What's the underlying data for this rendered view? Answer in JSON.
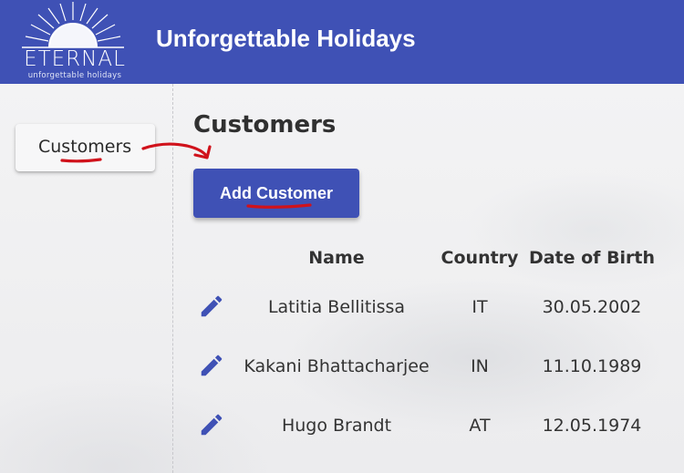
{
  "header": {
    "logo_word": "ETERNAL",
    "logo_tagline": "unforgettable holidays",
    "title": "Unforgettable Holidays",
    "color": "#3f51b5"
  },
  "sidebar": {
    "items": [
      {
        "label": "Customers",
        "icon": "none",
        "active": true
      }
    ]
  },
  "main": {
    "page_title": "Customers",
    "add_button_label": "Add Customer",
    "table": {
      "columns": [
        "",
        "Name",
        "Country",
        "Date of Birth"
      ],
      "rows": [
        {
          "edit_icon": "edit-pencil-icon",
          "name": "Latitia Bellitissa",
          "country": "IT",
          "dob": "30.05.2002"
        },
        {
          "edit_icon": "edit-pencil-icon",
          "name": "Kakani Bhattacharjee",
          "country": "IN",
          "dob": "11.10.1989"
        },
        {
          "edit_icon": "edit-pencil-icon",
          "name": "Hugo Brandt",
          "country": "AT",
          "dob": "12.05.1974"
        }
      ]
    }
  },
  "annotations": {
    "color": "#d0121b",
    "marks": [
      "underline-customers-nav",
      "arrow-to-add-button",
      "underline-add-customer"
    ]
  }
}
